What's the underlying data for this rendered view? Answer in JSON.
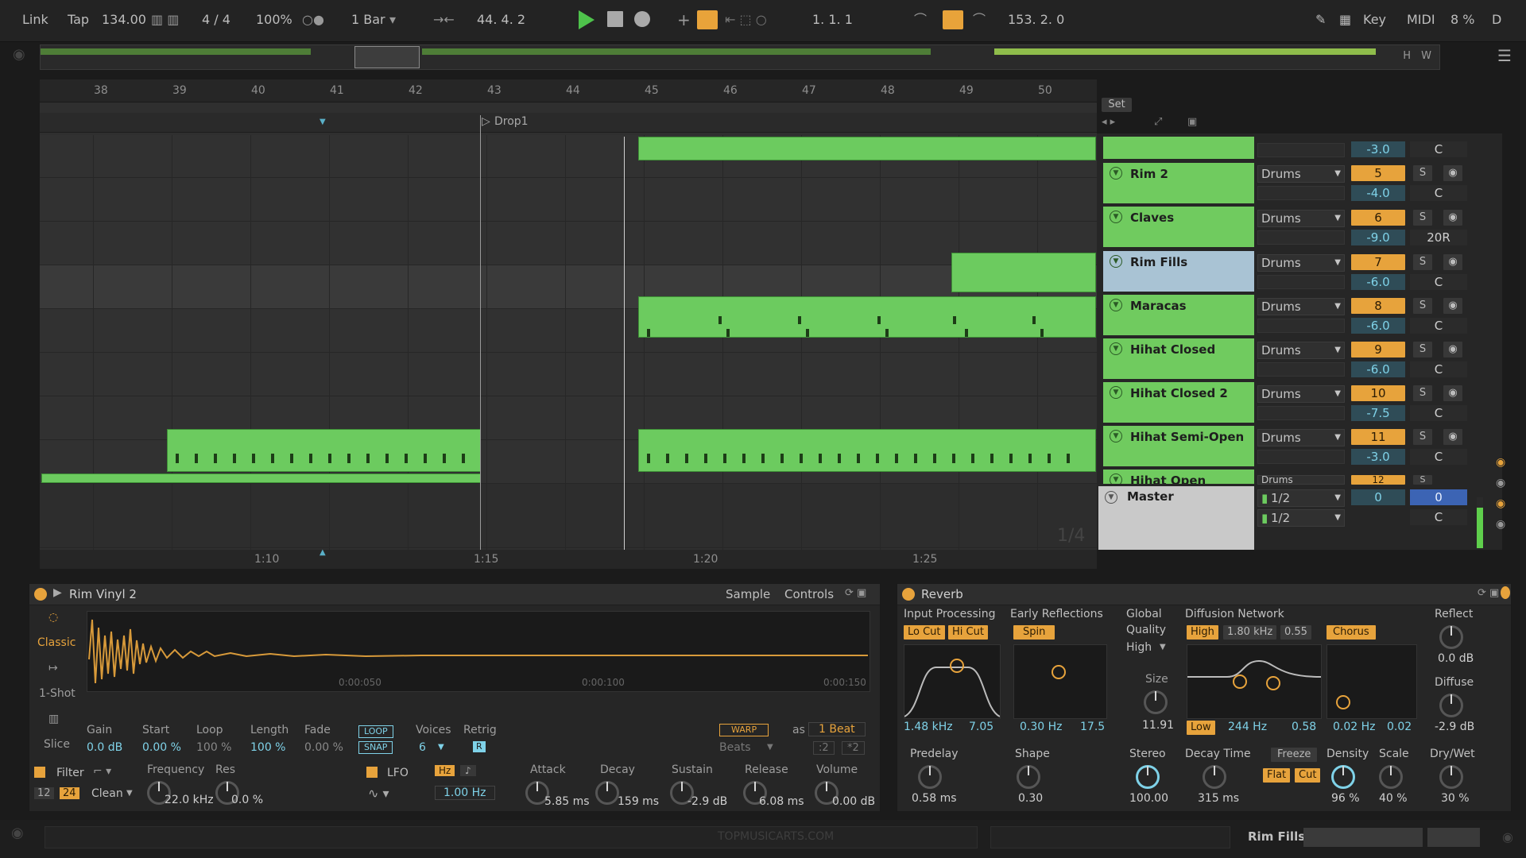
{
  "transport": {
    "link": "Link",
    "tap": "Tap",
    "tempo": "134.00",
    "signature": "4 / 4",
    "zoom": "100%",
    "quantize": "1 Bar",
    "position": "44.  4.  2",
    "loop_start": "1.  1.  1",
    "loop_length": "153.  2.  0",
    "key": "Key",
    "midi": "MIDI",
    "cpu": "8 %",
    "d": "D"
  },
  "overview": {
    "h": "H",
    "w": "W"
  },
  "ruler": {
    "bars": [
      "38",
      "39",
      "40",
      "41",
      "42",
      "43",
      "44",
      "45",
      "46",
      "47",
      "48",
      "49",
      "50"
    ],
    "set_label": "Set"
  },
  "locator": {
    "name": "Drop1"
  },
  "timeline": {
    "times": [
      "1:10",
      "1:15",
      "1:20",
      "1:25"
    ]
  },
  "tracks": [
    {
      "name": "",
      "input": "",
      "num": "",
      "vol": "-3.0",
      "pan": "C"
    },
    {
      "name": "Rim 2",
      "input": "Drums",
      "num": "5",
      "vol": "-4.0",
      "pan": "C"
    },
    {
      "name": "Claves",
      "input": "Drums",
      "num": "6",
      "vol": "-9.0",
      "pan": "20R"
    },
    {
      "name": "Rim Fills",
      "input": "Drums",
      "num": "7",
      "vol": "-6.0",
      "pan": "C"
    },
    {
      "name": "Maracas",
      "input": "Drums",
      "num": "8",
      "vol": "-6.0",
      "pan": "C"
    },
    {
      "name": "Hihat Closed",
      "input": "Drums",
      "num": "9",
      "vol": "-6.0",
      "pan": "C"
    },
    {
      "name": "Hihat Closed 2",
      "input": "Drums",
      "num": "10",
      "vol": "-7.5",
      "pan": "C"
    },
    {
      "name": "Hihat Semi-Open",
      "input": "Drums",
      "num": "11",
      "vol": "-3.0",
      "pan": "C"
    },
    {
      "name": "Hihat Open",
      "input": "Drums",
      "num": "12",
      "vol": "",
      "pan": ""
    }
  ],
  "master": {
    "name": "Master",
    "cue": "1/2",
    "out": "1/2",
    "vol": "0",
    "send": "0",
    "pan": "C",
    "fraction": "1/4"
  },
  "solo_label": "S",
  "sampler": {
    "title": "Rim Vinyl 2",
    "tab_sample": "Sample",
    "tab_controls": "Controls",
    "modes": [
      "Classic",
      "1-Shot",
      "Slice"
    ],
    "time_marks": [
      "0:00:050",
      "0:00:100",
      "0:00:150"
    ],
    "gain_label": "Gain",
    "gain": "0.0 dB",
    "start_label": "Start",
    "start": "0.00 %",
    "loop_label": "Loop",
    "loop": "100 %",
    "length_label": "Length",
    "length": "100 %",
    "fade_label": "Fade",
    "fade": "0.00 %",
    "loop_btn": "LOOP",
    "snap_btn": "SNAP",
    "voices_label": "Voices",
    "voices": "6",
    "retrig_label": "Retrig",
    "retrig": "R",
    "warp_btn": "WARP",
    "as": "as",
    "beat": "1 Beat",
    "beats": "Beats",
    "half": ":2",
    "double": "*2",
    "filter_label": "Filter",
    "f12": "12",
    "f24": "24",
    "clean": "Clean",
    "freq_label": "Frequency",
    "freq": "22.0 kHz",
    "res_label": "Res",
    "res": "0.0 %",
    "lfo_label": "LFO",
    "hz": "Hz",
    "lfo_rate": "1.00 Hz",
    "attack_label": "Attack",
    "attack": "5.85 ms",
    "decay_label": "Decay",
    "decay": "159 ms",
    "sustain_label": "Sustain",
    "sustain": "-2.9 dB",
    "release_label": "Release",
    "release": "6.08 ms",
    "volume_label": "Volume",
    "volume": "0.00 dB"
  },
  "reverb": {
    "title": "Reverb",
    "input_label": "Input Processing",
    "locut": "Lo Cut",
    "hicut": "Hi Cut",
    "in_freq": "1.48 kHz",
    "in_width": "7.05",
    "early_label": "Early Reflections",
    "spin": "Spin",
    "er_freq": "0.30 Hz",
    "er_amt": "17.5",
    "global_label": "Global",
    "quality_label": "Quality",
    "quality": "High",
    "size_label": "Size",
    "size": "11.91",
    "diff_label": "Diffusion Network",
    "high": "High",
    "high_freq": "1.80 kHz",
    "high_amt": "0.55",
    "chorus": "Chorus",
    "low": "Low",
    "low_freq": "244 Hz",
    "low_amt": "0.58",
    "ch_rate": "0.02 Hz",
    "ch_amt": "0.02",
    "reflect_label": "Reflect",
    "reflect": "0.0 dB",
    "diffuse_label": "Diffuse",
    "diffuse": "-2.9 dB",
    "predelay_label": "Predelay",
    "predelay": "0.58 ms",
    "shape_label": "Shape",
    "shape": "0.30",
    "stereo_label": "Stereo",
    "stereo": "100.00",
    "decay_label": "Decay Time",
    "decay": "315 ms",
    "freeze": "Freeze",
    "flat": "Flat",
    "cut": "Cut",
    "density_label": "Density",
    "density": "96 %",
    "scale_label": "Scale",
    "scale": "40 %",
    "drywet_label": "Dry/Wet",
    "drywet": "30 %"
  },
  "status": {
    "track": "Rim Fills",
    "watermark": "TOPMUSICARTS.COM"
  }
}
